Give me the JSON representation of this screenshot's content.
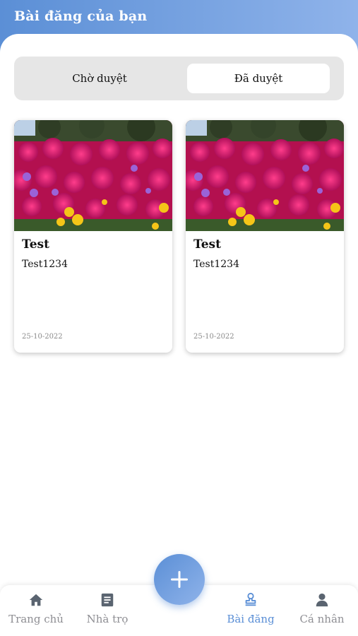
{
  "header": {
    "title": "Bài đăng của bạn"
  },
  "tabs": {
    "pending_label": "Chờ duyệt",
    "approved_label": "Đã duyệt",
    "active": "approved"
  },
  "posts": [
    {
      "title": "Test",
      "description": "Test1234",
      "date": "25-10-2022"
    },
    {
      "title": "Test",
      "description": "Test1234",
      "date": "25-10-2022"
    }
  ],
  "nav": {
    "items": [
      {
        "label": "Trang chủ",
        "icon": "home-icon",
        "active": false
      },
      {
        "label": "Nhà trọ",
        "icon": "document-icon",
        "active": false
      },
      {
        "label": "Bài đăng",
        "icon": "stamp-icon",
        "active": true
      },
      {
        "label": "Cá nhân",
        "icon": "person-icon",
        "active": false
      }
    ],
    "fab_icon": "plus-icon"
  },
  "colors": {
    "accent": "#5b8fd6",
    "inactive": "#8e8e93",
    "segment_bg": "#e6e6e6"
  }
}
